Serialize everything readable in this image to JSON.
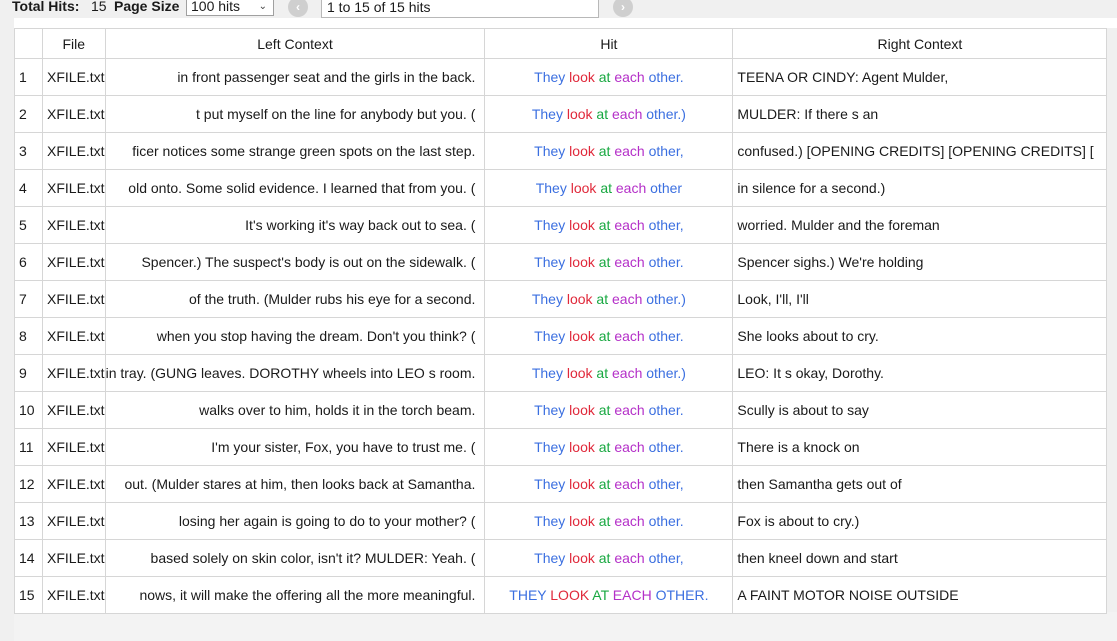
{
  "toolbar": {
    "total_hits_label": "Total Hits:",
    "total_hits_value": "15",
    "page_size_label": "Page Size",
    "page_size_value": "100 hits",
    "hits_range": "1 to 15 of 15 hits",
    "prev_icon": "chevron-left-circle-icon",
    "next_icon": "chevron-right-circle-icon"
  },
  "colors": {
    "they": "#3b6fe0",
    "look": "#e0283a",
    "at": "#17a840",
    "each": "#b42fc8",
    "other": "#3b6fe0"
  },
  "table": {
    "headers": {
      "file": "File",
      "left": "Left Context",
      "hit": "Hit",
      "right": "Right Context"
    },
    "rows": [
      {
        "num": "1",
        "file": "XFILE.txt",
        "left": "in front passenger seat and the girls in the back.",
        "hit": [
          "They",
          "look",
          "at",
          "each",
          "other."
        ],
        "right": "TEENA OR CINDY: Agent Mulder,"
      },
      {
        "num": "2",
        "file": "XFILE.txt",
        "left": "t put myself on the line for anybody but you. (",
        "hit": [
          "They",
          "look",
          "at",
          "each",
          "other.)"
        ],
        "right": "MULDER: If there s an"
      },
      {
        "num": "3",
        "file": "XFILE.txt",
        "left": "ficer notices some strange green spots on the last step.",
        "hit": [
          "They",
          "look",
          "at",
          "each",
          "other,"
        ],
        "right": "confused.) [OPENING CREDITS] [OPENING CREDITS] ["
      },
      {
        "num": "4",
        "file": "XFILE.txt",
        "left": "old onto. Some solid evidence. I learned that from you. (",
        "hit": [
          "They",
          "look",
          "at",
          "each",
          "other"
        ],
        "right": "in silence for a second.)"
      },
      {
        "num": "5",
        "file": "XFILE.txt",
        "left": "It's working it's way back out to sea. (",
        "hit": [
          "They",
          "look",
          "at",
          "each",
          "other,"
        ],
        "right": "worried. Mulder and the foreman"
      },
      {
        "num": "6",
        "file": "XFILE.txt",
        "left": "Spencer.) The suspect's body is out on the sidewalk. (",
        "hit": [
          "They",
          "look",
          "at",
          "each",
          "other."
        ],
        "right": "Spencer sighs.) We're holding"
      },
      {
        "num": "7",
        "file": "XFILE.txt",
        "left": "of the truth. (Mulder rubs his eye for a second.",
        "hit": [
          "They",
          "look",
          "at",
          "each",
          "other.)"
        ],
        "right": "Look, I'll, I'll"
      },
      {
        "num": "8",
        "file": "XFILE.txt",
        "left": "when you stop having the dream. Don't you think? (",
        "hit": [
          "They",
          "look",
          "at",
          "each",
          "other."
        ],
        "right": "She looks about to cry."
      },
      {
        "num": "9",
        "file": "XFILE.txt",
        "left": "in tray. (GUNG leaves. DOROTHY wheels into LEO s room.",
        "hit": [
          "They",
          "look",
          "at",
          "each",
          "other.)"
        ],
        "right": "LEO: It s okay, Dorothy."
      },
      {
        "num": "10",
        "file": "XFILE.txt",
        "left": "walks over to him, holds it in the torch beam.",
        "hit": [
          "They",
          "look",
          "at",
          "each",
          "other."
        ],
        "right": "Scully is about to say"
      },
      {
        "num": "11",
        "file": "XFILE.txt",
        "left": "I'm your sister, Fox, you have to trust me. (",
        "hit": [
          "They",
          "look",
          "at",
          "each",
          "other."
        ],
        "right": "There is a knock on"
      },
      {
        "num": "12",
        "file": "XFILE.txt",
        "left": "out. (Mulder stares at him, then looks back at Samantha.",
        "hit": [
          "They",
          "look",
          "at",
          "each",
          "other,"
        ],
        "right": "then Samantha gets out of"
      },
      {
        "num": "13",
        "file": "XFILE.txt",
        "left": "losing her again is going to do to your mother? (",
        "hit": [
          "They",
          "look",
          "at",
          "each",
          "other."
        ],
        "right": "Fox is about to cry.)"
      },
      {
        "num": "14",
        "file": "XFILE.txt",
        "left": "based solely on skin color, isn't it? MULDER: Yeah. (",
        "hit": [
          "They",
          "look",
          "at",
          "each",
          "other,"
        ],
        "right": "then kneel down and start"
      },
      {
        "num": "15",
        "file": "XFILE.txt",
        "left": "nows, it will make the offering all the more meaningful.",
        "hit": [
          "THEY",
          "LOOK",
          "AT",
          "EACH",
          "OTHER."
        ],
        "right": "A FAINT MOTOR NOISE OUTSIDE"
      }
    ]
  }
}
